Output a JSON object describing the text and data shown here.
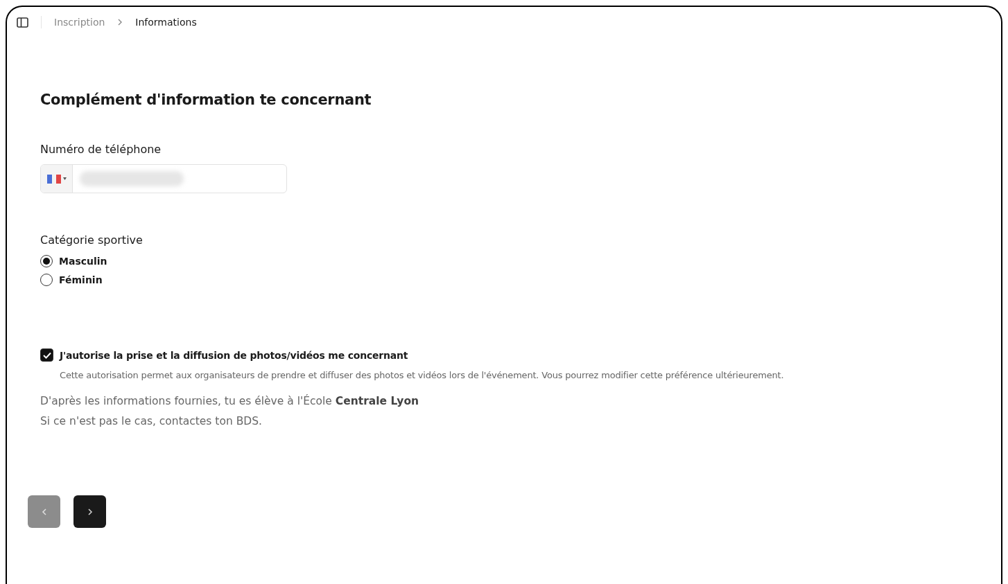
{
  "breadcrumb": [
    {
      "label": "Inscription",
      "current": false
    },
    {
      "label": "Informations",
      "current": true
    }
  ],
  "title": "Complément d'information te concernant",
  "phone": {
    "label": "Numéro de téléphone",
    "value_hidden": true
  },
  "category": {
    "label": "Catégorie sportive",
    "options": [
      {
        "label": "Masculin",
        "selected": true
      },
      {
        "label": "Féminin",
        "selected": false
      }
    ]
  },
  "consent": {
    "checked": true,
    "label": "J'autorise la prise et la diffusion de photos/vidéos me concernant",
    "description": "Cette autorisation permet aux organisateurs de prendre et diffuser des photos et vidéos lors de l'événement. Vous pourrez modifier cette préférence ultérieurement."
  },
  "info": [
    "D'après les informations fournies, tu es élève à l'École **Centrale Lyon**",
    "Si ce n'est pas le cas, contactes ton BDS."
  ],
  "nav": [
    {
      "kind": "back",
      "disabled": true
    },
    {
      "kind": "next",
      "disabled": false
    }
  ]
}
